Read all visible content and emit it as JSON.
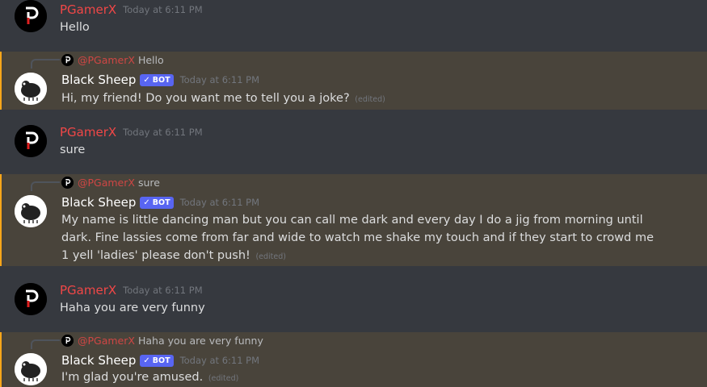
{
  "messages": [
    {
      "author": "PGamerX",
      "time": "Today at 6:11 PM",
      "text": "Hello"
    },
    {
      "reply": {
        "name": "@PGamerX",
        "text": "Hello"
      },
      "author": "Black Sheep",
      "bot_tag": "BOT",
      "time": "Today at 6:11 PM",
      "text": "Hi, my friend! Do you want me to tell you a joke?",
      "edited": "(edited)"
    },
    {
      "author": "PGamerX",
      "time": "Today at 6:11 PM",
      "text": "sure"
    },
    {
      "reply": {
        "name": "@PGamerX",
        "text": "sure"
      },
      "author": "Black Sheep",
      "bot_tag": "BOT",
      "time": "Today at 6:11 PM",
      "text": "My name is little dancing man but you can call me dark and every day I do a jig from morning until dark. Fine lassies come from far and wide to watch me shake my touch and if they start to crowd me 1 yell 'ladies' please don't push!",
      "edited": "(edited)"
    },
    {
      "author": "PGamerX",
      "time": "Today at 6:11 PM",
      "text": "Haha you are very funny"
    },
    {
      "reply": {
        "name": "@PGamerX",
        "text": "Haha you are very funny"
      },
      "author": "Black Sheep",
      "bot_tag": "BOT",
      "time": "Today at 6:11 PM",
      "text": "I'm glad you're amused.",
      "edited": "(edited)"
    }
  ],
  "colors": {
    "background": "#36393f",
    "user_name": "#f04747",
    "bot_name": "#ffffff",
    "bot_tag": "#5865f2",
    "mention_border": "#faa61a",
    "timestamp": "#72767d"
  },
  "icons": {
    "user_avatar": "pgamerx-logo-icon",
    "bot_avatar": "black-sheep-icon",
    "verified": "checkmark-icon"
  }
}
